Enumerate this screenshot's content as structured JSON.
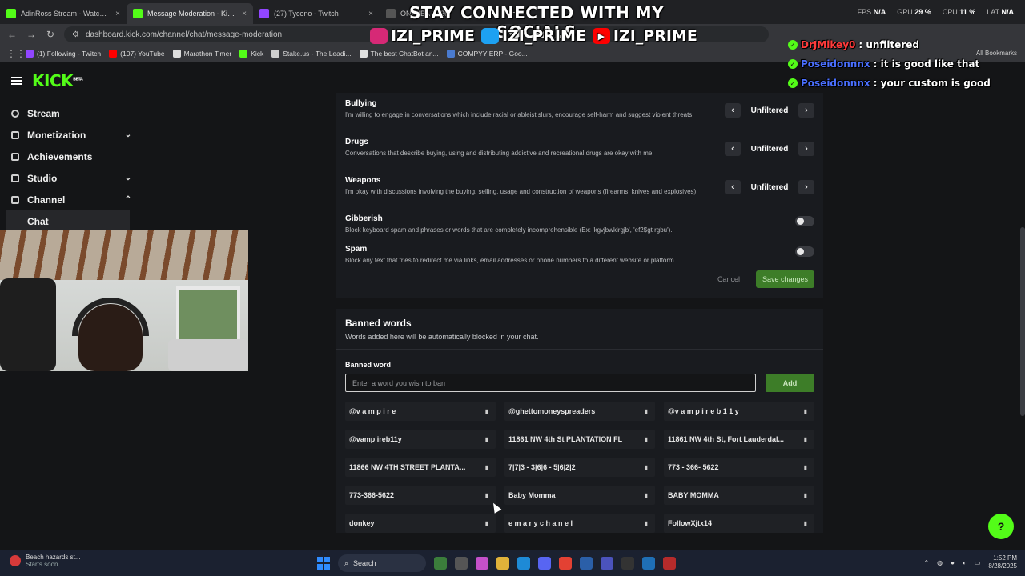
{
  "browser": {
    "tabs": [
      {
        "title": "AdinRoss Stream - Watch Live",
        "color": "#53fc18"
      },
      {
        "title": "Message Moderation - Kick Da",
        "color": "#53fc18",
        "active": true
      },
      {
        "title": "(27) Tyceno - Twitch",
        "color": "#9146ff"
      },
      {
        "title": "ON] NBA 2K26",
        "color": "#555555"
      }
    ],
    "url": "dashboard.kick.com/channel/chat/message-moderation",
    "bookmarks": [
      {
        "label": "(1) Following - Twitch",
        "color": "#9146ff"
      },
      {
        "label": "(107) YouTube",
        "color": "#ff0000"
      },
      {
        "label": "Marathon Timer",
        "color": "#dddddd"
      },
      {
        "label": "Kick",
        "color": "#53fc18"
      },
      {
        "label": "Stake.us - The Leadi...",
        "color": "#cfcfcf"
      },
      {
        "label": "The best ChatBot an...",
        "color": "#e0e0e0"
      },
      {
        "label": "COMPYY ERP - Goo...",
        "color": "#4a7bd0"
      }
    ],
    "all_bookmarks": "All Bookmarks"
  },
  "perf": {
    "fps_label": "FPS",
    "fps": "N/A",
    "gpu_label": "GPU",
    "gpu": "29 %",
    "cpu_label": "CPU",
    "cpu": "11 %",
    "lat_label": "LAT",
    "lat": "N/A"
  },
  "overlay": {
    "banner": "STAY CONNECTED WITH MY SOCIALS",
    "socials": [
      {
        "icon": "instagram-icon",
        "handle": "IZI_PRIME",
        "color": "#d62976"
      },
      {
        "icon": "twitter-icon",
        "handle": "IZI_PRIME",
        "color": "#1da1f2"
      },
      {
        "icon": "youtube-icon",
        "handle": "IZI_PRIME",
        "color": "#ff0000"
      }
    ],
    "chat": [
      {
        "user": "DrJMikey0",
        "text": ": unfiltered",
        "red": true
      },
      {
        "user": "Poseidonnnx",
        "text": ": it is good like that",
        "red": false
      },
      {
        "user": "Poseidonnnx",
        "text": ": your custom is good",
        "red": false
      }
    ]
  },
  "kick": {
    "logo": "KICK",
    "logo_tag": "BETA",
    "sidebar": [
      {
        "label": "Stream",
        "chev": ""
      },
      {
        "label": "Monetization",
        "chev": "⌄"
      },
      {
        "label": "Achievements",
        "chev": ""
      },
      {
        "label": "Studio",
        "chev": "⌄"
      },
      {
        "label": "Channel",
        "chev": "⌃"
      }
    ],
    "sidebar_active": "Chat",
    "filters": [
      {
        "name": "Bullying",
        "desc": "I'm willing to engage in conversations which include racial or ableist slurs, encourage self-harm and suggest violent threats.",
        "value": "Unfiltered"
      },
      {
        "name": "Drugs",
        "desc": "Conversations that describe buying, using and distributing addictive and recreational drugs are okay with me.",
        "value": "Unfiltered"
      },
      {
        "name": "Weapons",
        "desc": "I'm okay with discussions involving the buying, selling, usage and construction of weapons (firearms, knives and explosives).",
        "value": "Unfiltered"
      }
    ],
    "toggles": [
      {
        "name": "Gibberish",
        "desc": "Block keyboard spam and phrases or words that are completely incomprehensible (Ex: 'kgvjbwkirgjb', 'ef2$gt rgbu')."
      },
      {
        "name": "Spam",
        "desc": "Block any text that tries to redirect me via links, email addresses or phone numbers to a different website or platform."
      }
    ],
    "cancel": "Cancel",
    "save": "Save changes",
    "banned": {
      "title": "Banned words",
      "subtitle": "Words added here will be automatically blocked in your chat.",
      "label": "Banned word",
      "placeholder": "Enter a word you wish to ban",
      "add": "Add",
      "words": [
        "@v a m p i r e",
        "@ghettomoneyspreaders",
        "@v a m p i r e b 1 1 y",
        "@vamp ireb11y",
        "11861 NW 4th St PLANTATION FL",
        "11861 NW 4th St, Fort Lauderdal...",
        "11866 NW 4TH STREET PLANTA...",
        "7|7|3 - 3|6|6 - 5|6|2|2",
        "773 - 366- 5622",
        "773-366-5622",
        "Baby Momma",
        "BABY MOMMA",
        "donkey",
        "e m a r y c h a n e l",
        "FollowXjtx14"
      ]
    }
  },
  "taskbar": {
    "weather_title": "Beach hazards st...",
    "weather_sub": "Starts soon",
    "search": "Search",
    "time": "1:52 PM",
    "date": "8/28/2025"
  }
}
